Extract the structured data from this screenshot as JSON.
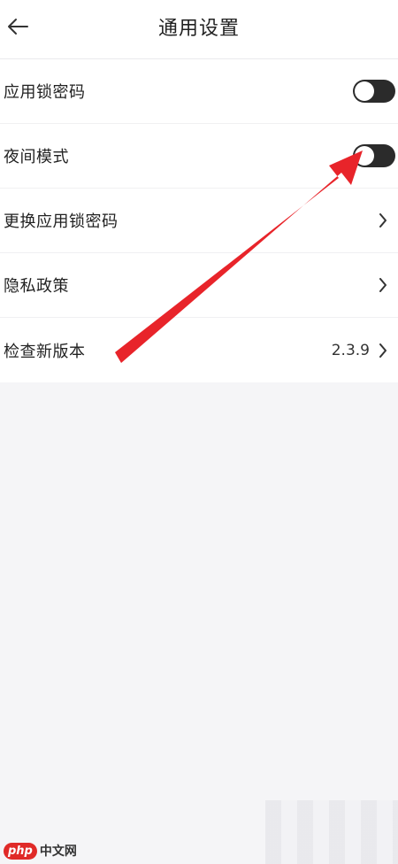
{
  "header": {
    "title": "通用设置",
    "back_icon": "arrow-left-icon"
  },
  "settings": [
    {
      "label": "应用锁密码",
      "control": "toggle",
      "on": false
    },
    {
      "label": "夜间模式",
      "control": "toggle",
      "on": false
    },
    {
      "label": "更换应用锁密码",
      "control": "chevron"
    },
    {
      "label": "隐私政策",
      "control": "chevron"
    },
    {
      "label": "检查新版本",
      "control": "chevron",
      "value": "2.3.9"
    }
  ],
  "annotation": {
    "arrow_color": "#e8242a"
  },
  "watermark": {
    "logo": "php",
    "text": "中文网"
  }
}
